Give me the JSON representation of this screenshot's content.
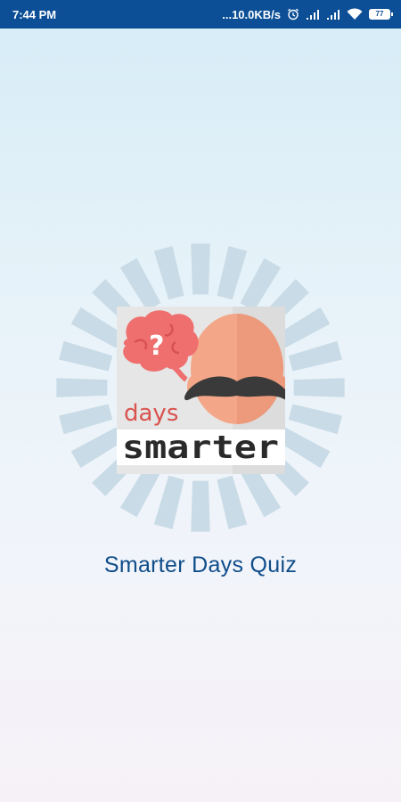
{
  "status_bar": {
    "time": "7:44 PM",
    "net_speed": "...10.0KB/s",
    "battery_level": "77",
    "icons": [
      "alarm-icon",
      "signal-icon",
      "signal-icon",
      "wifi-icon",
      "battery-icon"
    ]
  },
  "splash": {
    "logo_word_small": "days",
    "logo_word_big": "smarter",
    "logo_brain_mark": "?",
    "app_title": "Smarter Days Quiz"
  },
  "colors": {
    "status_bar": "#0c4f96",
    "title": "#0f4d8a",
    "brain": "#ef6f6f",
    "face": "#f4a788",
    "mustache": "#3b3b3b"
  }
}
